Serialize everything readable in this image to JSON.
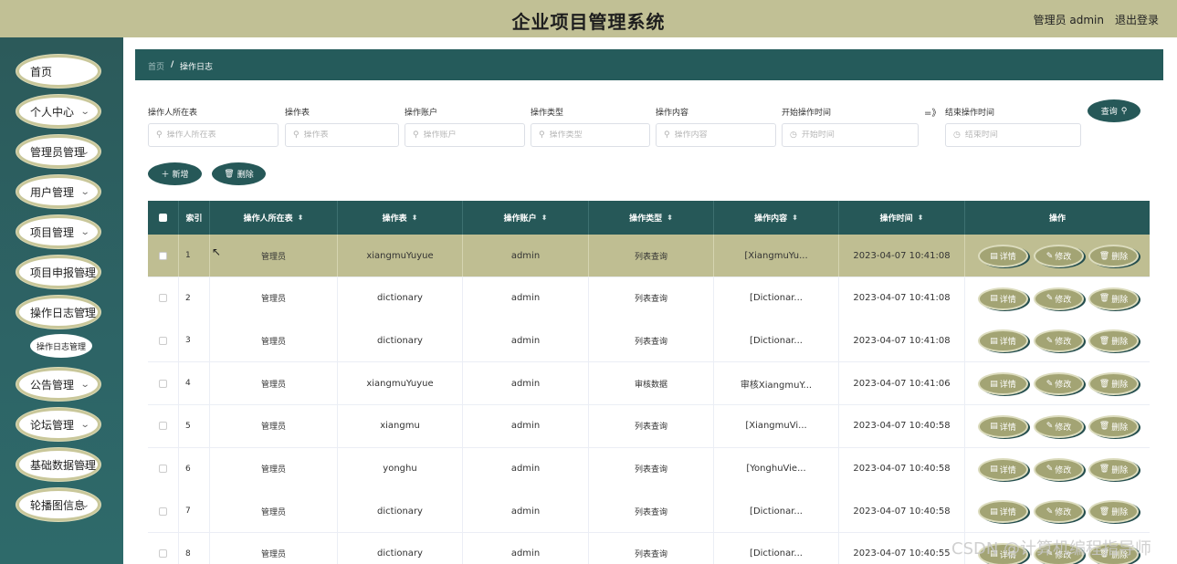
{
  "header": {
    "title": "企业项目管理系统",
    "user": "管理员 admin",
    "logout": "退出登录"
  },
  "sidebar": {
    "items": [
      {
        "label": "首页",
        "expandable": false
      },
      {
        "label": "个人中心",
        "expandable": true
      },
      {
        "label": "管理员管理",
        "expandable": true
      },
      {
        "label": "用户管理",
        "expandable": true
      },
      {
        "label": "项目管理",
        "expandable": true
      },
      {
        "label": "项目申报管理",
        "expandable": true
      },
      {
        "label": "操作日志管理",
        "expandable": true
      },
      {
        "label": "公告管理",
        "expandable": true
      },
      {
        "label": "论坛管理",
        "expandable": true
      },
      {
        "label": "基础数据管理",
        "expandable": true
      },
      {
        "label": "轮播图信息",
        "expandable": true
      }
    ],
    "submenu": {
      "label": "操作日志管理"
    }
  },
  "breadcrumb": {
    "home": "首页",
    "separator": "/",
    "current": "操作日志"
  },
  "search": {
    "fields": [
      {
        "label": "操作人所在表",
        "placeholder": "操作人所在表"
      },
      {
        "label": "操作表",
        "placeholder": "操作表"
      },
      {
        "label": "操作账户",
        "placeholder": "操作账户"
      },
      {
        "label": "操作类型",
        "placeholder": "操作类型"
      },
      {
        "label": "操作内容",
        "placeholder": "操作内容"
      },
      {
        "label": "开始操作时间",
        "placeholder": "开始时间"
      },
      {
        "label": "结束操作时间",
        "placeholder": "结束时间"
      }
    ],
    "range_separator": "=》",
    "query_button": "查询"
  },
  "toolbar": {
    "add": "新增",
    "delete": "删除"
  },
  "table": {
    "columns": [
      "索引",
      "操作人所在表",
      "操作表",
      "操作账户",
      "操作类型",
      "操作内容",
      "操作时间",
      "操作"
    ],
    "rows": [
      {
        "index": "1",
        "user_table": "管理员",
        "table": "xiangmuYuyue",
        "account": "admin",
        "type": "列表查询",
        "content": "[XiangmuYu...",
        "time": "2023-04-07 10:41:08"
      },
      {
        "index": "2",
        "user_table": "管理员",
        "table": "dictionary",
        "account": "admin",
        "type": "列表查询",
        "content": "[Dictionar...",
        "time": "2023-04-07 10:41:08"
      },
      {
        "index": "3",
        "user_table": "管理员",
        "table": "dictionary",
        "account": "admin",
        "type": "列表查询",
        "content": "[Dictionar...",
        "time": "2023-04-07 10:41:08"
      },
      {
        "index": "4",
        "user_table": "管理员",
        "table": "xiangmuYuyue",
        "account": "admin",
        "type": "审核数据",
        "content": "审核XiangmuY...",
        "time": "2023-04-07 10:41:06"
      },
      {
        "index": "5",
        "user_table": "管理员",
        "table": "xiangmu",
        "account": "admin",
        "type": "列表查询",
        "content": "[XiangmuVi...",
        "time": "2023-04-07 10:40:58"
      },
      {
        "index": "6",
        "user_table": "管理员",
        "table": "yonghu",
        "account": "admin",
        "type": "列表查询",
        "content": "[YonghuVie...",
        "time": "2023-04-07 10:40:58"
      },
      {
        "index": "7",
        "user_table": "管理员",
        "table": "dictionary",
        "account": "admin",
        "type": "列表查询",
        "content": "[Dictionar...",
        "time": "2023-04-07 10:40:58"
      },
      {
        "index": "8",
        "user_table": "管理员",
        "table": "dictionary",
        "account": "admin",
        "type": "列表查询",
        "content": "[Dictionar...",
        "time": "2023-04-07 10:40:55"
      }
    ],
    "actions": {
      "detail": "详情",
      "edit": "修改",
      "delete": "删除"
    }
  },
  "watermark": "CSDN @计算机编程指导师",
  "colors": {
    "header": "#c1c095",
    "sidebar": "#2c5a5a",
    "primary": "#265858",
    "highlight_row": "#bfbe92",
    "action_button": "#a3a474"
  }
}
